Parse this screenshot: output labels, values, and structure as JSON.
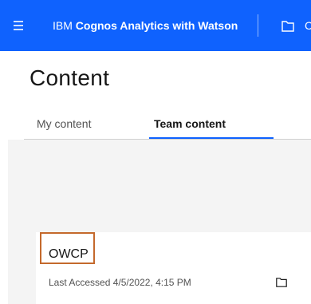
{
  "header": {
    "brand": "IBM",
    "product": "Cognos Analytics with Watson",
    "truncated_label": "C",
    "accent_color": "#0f62fe",
    "icons": [
      "hamburger-menu-icon",
      "folder-icon"
    ]
  },
  "page": {
    "title": "Content"
  },
  "tabs": [
    {
      "label": "My content",
      "selected": false
    },
    {
      "label": "Team content",
      "selected": true
    }
  ],
  "items": [
    {
      "title": "OWCP",
      "last_accessed": "Last Accessed 4/5/2022, 4:15 PM",
      "icon": "folder-icon",
      "highlight_color": "#c4692c"
    }
  ]
}
